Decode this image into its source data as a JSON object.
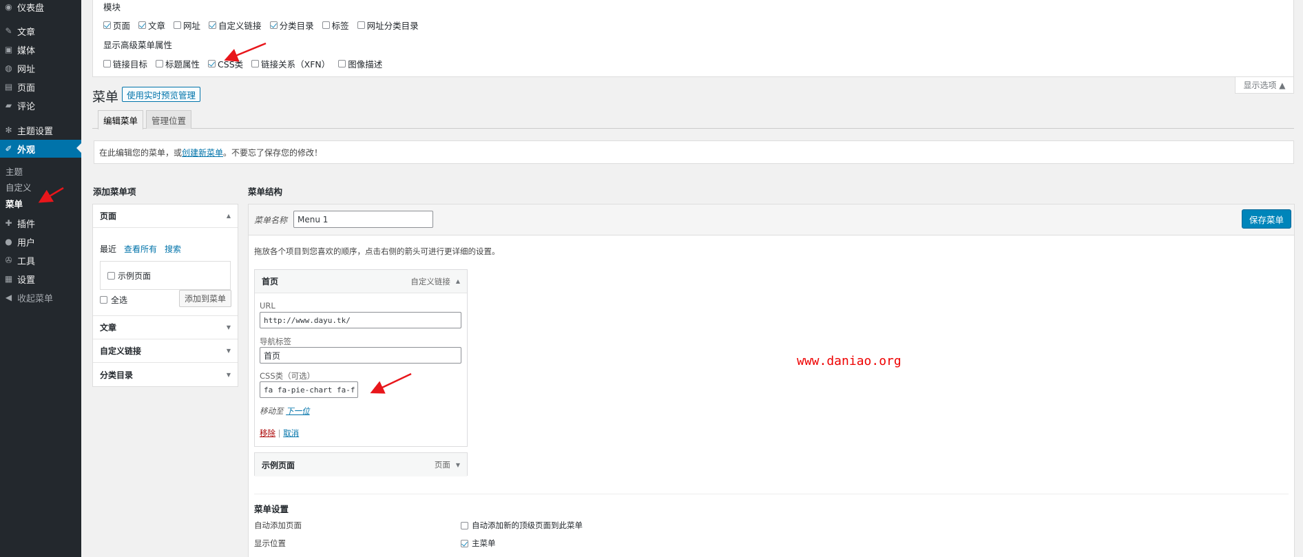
{
  "sidebar": {
    "items": [
      {
        "label": "仪表盘",
        "icon": "dashboard-icon",
        "glyph": "◉"
      },
      {
        "label": "文章",
        "icon": "pin-icon",
        "glyph": "✎"
      },
      {
        "label": "媒体",
        "icon": "media-icon",
        "glyph": "▣"
      },
      {
        "label": "网址",
        "icon": "globe-icon",
        "glyph": "◍"
      },
      {
        "label": "页面",
        "icon": "page-icon",
        "glyph": "▤"
      },
      {
        "label": "评论",
        "icon": "comment-icon",
        "glyph": "▰"
      },
      {
        "label": "主题设置",
        "icon": "gear-icon",
        "glyph": "✻"
      },
      {
        "label": "外观",
        "icon": "brush-icon",
        "glyph": "✐"
      },
      {
        "label": "插件",
        "icon": "plugin-icon",
        "glyph": "✚"
      },
      {
        "label": "用户",
        "icon": "user-icon",
        "glyph": "●"
      },
      {
        "label": "工具",
        "icon": "wrench-icon",
        "glyph": "✇"
      },
      {
        "label": "设置",
        "icon": "settings-icon",
        "glyph": "▦"
      },
      {
        "label": "收起菜单",
        "icon": "collapse-icon",
        "glyph": "◀"
      }
    ],
    "submenu": [
      "主题",
      "自定义",
      "菜单"
    ]
  },
  "screen_options": {
    "modules_title": "模块",
    "modules": [
      {
        "label": "页面",
        "checked": true
      },
      {
        "label": "文章",
        "checked": true
      },
      {
        "label": "网址",
        "checked": false
      },
      {
        "label": "自定义链接",
        "checked": true
      },
      {
        "label": "分类目录",
        "checked": true
      },
      {
        "label": "标签",
        "checked": false
      },
      {
        "label": "网址分类目录",
        "checked": false
      }
    ],
    "advanced_title": "显示高级菜单属性",
    "advanced": [
      {
        "label": "链接目标",
        "checked": false
      },
      {
        "label": "标题属性",
        "checked": false
      },
      {
        "label": "CSS类",
        "checked": true
      },
      {
        "label": "链接关系（XFN）",
        "checked": false
      },
      {
        "label": "图像描述",
        "checked": false
      }
    ],
    "toggle_label": "显示选项 ▲"
  },
  "header": {
    "title": "菜单",
    "action_label": "使用实时预览管理",
    "tabs": [
      "编辑菜单",
      "管理位置"
    ]
  },
  "notice": {
    "before": "在此编辑您的菜单，或",
    "link": "创建新菜单",
    "after": "。不要忘了保存您的修改！"
  },
  "add_items": {
    "heading": "添加菜单项",
    "pages_title": "页面",
    "inner_tabs": [
      "最近",
      "查看所有",
      "搜索"
    ],
    "sample_page": "示例页面",
    "select_all": "全选",
    "add_button": "添加到菜单",
    "sections": [
      "文章",
      "自定义链接",
      "分类目录"
    ]
  },
  "menu_structure": {
    "heading": "菜单结构",
    "name_label": "菜单名称",
    "name_value": "Menu 1",
    "save_button": "保存菜单",
    "instructions": "拖放各个项目到您喜欢的顺序，点击右侧的箭头可进行更详细的设置。",
    "item1": {
      "title": "首页",
      "type": "自定义链接",
      "url_label": "URL",
      "url_value": "http://www.dayu.tk/",
      "nav_label": "导航标签",
      "nav_value": "首页",
      "css_label": "CSS类（可选）",
      "css_value": "fa fa-pie-chart fa-f",
      "move_label": "移动至",
      "move_link": "下一位",
      "remove": "移除",
      "sep": "|",
      "cancel": "取消"
    },
    "item2": {
      "title": "示例页面",
      "type": "页面"
    },
    "settings": {
      "title": "菜单设置",
      "auto_add_label": "自动添加页面",
      "auto_add_option": "自动添加新的顶级页面到此菜单",
      "auto_add_checked": false,
      "location_label": "显示位置",
      "location_option": "主菜单",
      "location_checked": true
    }
  },
  "watermark": "www.daniao.org",
  "colors": {
    "accent": "#0073aa",
    "sidebar_bg": "#23282d",
    "annotation": "#e8161b"
  }
}
